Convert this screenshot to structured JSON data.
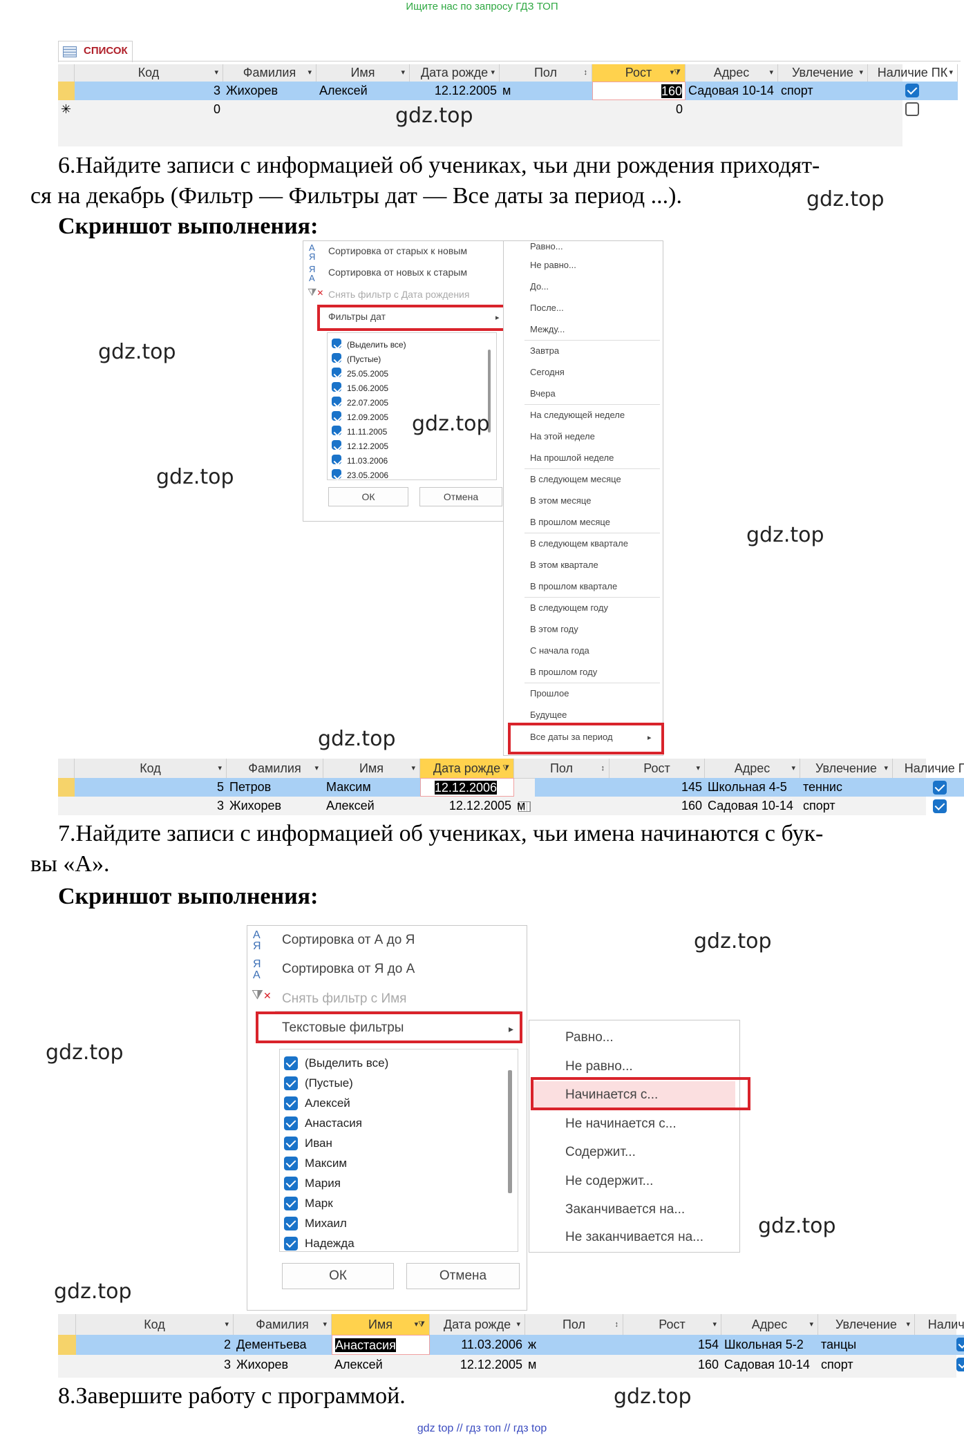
{
  "top_link": "Ищите нас по запросу ГДЗ ТОП",
  "bottom_link": "gdz top  //  гдз топ  //  гдз top",
  "watermark": "gdz.top",
  "table1": {
    "tab": "список",
    "columns": [
      "Код",
      "Фамилия",
      "Имя",
      "Дата рожде",
      "Пол",
      "Рост",
      "Адрес",
      "Увлечение",
      "Наличие ПК"
    ],
    "rows": [
      {
        "kod": "3",
        "fam": "Жихорев",
        "imya": "Алексей",
        "date": "12.12.2005",
        "pol": "м",
        "rost": "160",
        "adres": "Садовая 10-14",
        "hobby": "спорт",
        "pc": true
      }
    ],
    "new_row": {
      "marker": "✳",
      "kod": "0",
      "rost": "0"
    }
  },
  "task6": {
    "text1": "6.Найдите записи с информацией об учениках, чьи дни рождения приходят-",
    "text2": "ся на декабрь (Фильтр — Фильтры дат — Все даты за период ...).",
    "label": "Скриншот выполнения:"
  },
  "menu6": {
    "items": [
      "Сортировка от старых к новым",
      "Сортировка от новых к старым",
      "Снять фильтр с Дата рождения",
      "Фильтры дат"
    ],
    "list": [
      "(Выделить все)",
      "(Пустые)",
      "25.05.2005",
      "15.06.2005",
      "22.07.2005",
      "12.09.2005",
      "11.11.2005",
      "12.12.2005",
      "11.03.2006",
      "23.05.2006"
    ],
    "ok": "ОК",
    "cancel": "Отмена"
  },
  "submenu6": [
    "Равно...",
    "Не равно...",
    "До...",
    "После...",
    "Между...",
    "Завтра",
    "Сегодня",
    "Вчера",
    "На следующей неделе",
    "На этой неделе",
    "На прошлой неделе",
    "В следующем месяце",
    "В этом месяце",
    "В прошлом месяце",
    "В следующем квартале",
    "В этом квартале",
    "В прошлом квартале",
    "В следующем году",
    "В этом году",
    "С начала года",
    "В прошлом году",
    "Прошлое",
    "Будущее",
    "Все даты за период"
  ],
  "table2": {
    "columns": [
      "Код",
      "Фамилия",
      "Имя",
      "Дата рожде",
      "Пол",
      "Рост",
      "Адрес",
      "Увлечение",
      "Наличие ПК"
    ],
    "rows": [
      {
        "kod": "5",
        "fam": "Петров",
        "imya": "Максим",
        "date": "12.12.2006",
        "pol": "",
        "rost": "145",
        "adres": "Школьная 4-5",
        "hobby": "теннис",
        "pc": true
      },
      {
        "kod": "3",
        "fam": "Жихорев",
        "imya": "Алексей",
        "date": "12.12.2005",
        "pol": "м",
        "rost": "160",
        "adres": "Садовая 10-14",
        "hobby": "спорт",
        "pc": true
      }
    ]
  },
  "task7": {
    "text1": "7.Найдите записи с информацией об учениках, чьи имена начинаются с бук-",
    "text2": "вы «А».",
    "label": "Скриншот выполнения:"
  },
  "menu7": {
    "items": [
      "Сортировка от А до Я",
      "Сортировка от Я до А",
      "Снять фильтр с Имя",
      "Текстовые фильтры"
    ],
    "list": [
      "(Выделить все)",
      "(Пустые)",
      "Алексей",
      "Анастасия",
      "Иван",
      "Максим",
      "Мария",
      "Марк",
      "Михаил",
      "Надежда"
    ],
    "ok": "ОК",
    "cancel": "Отмена"
  },
  "submenu7": [
    "Равно...",
    "Не равно...",
    "Начинается с...",
    "Не начинается с...",
    "Содержит...",
    "Не содержит...",
    "Заканчивается на...",
    "Не заканчивается на..."
  ],
  "table3": {
    "columns": [
      "Код",
      "Фамилия",
      "Имя",
      "Дата рожде",
      "Пол",
      "Рост",
      "Адрес",
      "Увлечение",
      "Наличие ПК"
    ],
    "rows": [
      {
        "kod": "2",
        "fam": "Дементьева",
        "imya": "Анастасия",
        "date": "11.03.2006",
        "pol": "ж",
        "rost": "154",
        "adres": "Школьная 5-2",
        "hobby": "танцы",
        "pc": true
      },
      {
        "kod": "3",
        "fam": "Жихорев",
        "imya": "Алексей",
        "date": "12.12.2005",
        "pol": "м",
        "rost": "160",
        "adres": "Садовая 10-14",
        "hobby": "спорт",
        "pc": true
      }
    ]
  },
  "task8": {
    "text": "8.Завершите работу с программой."
  }
}
